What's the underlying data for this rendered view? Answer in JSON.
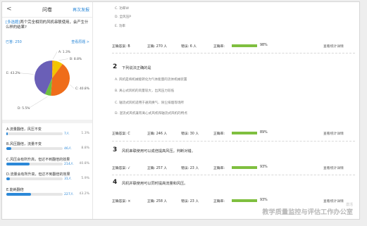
{
  "header": {
    "back": "<",
    "title": "问卷",
    "retake": "再次发报"
  },
  "question": {
    "tag": "[多选题]",
    "text": "两个完全相同的风机串联使用，会产生什么样的结果?"
  },
  "answered": "已答: 250",
  "view_question": "查看原题 >",
  "pie": {
    "labels": [
      "A: 1.3%",
      "B: 8.8%",
      "C: 40.8%",
      "D: 5.5%",
      "E: 43.2%"
    ],
    "colors": [
      "#f29c1f",
      "#f2c500",
      "#ef6d1a",
      "#6fbf3f",
      "#6a5fb7"
    ],
    "values": [
      1.3,
      8.8,
      40.8,
      5.5,
      43.2
    ]
  },
  "stats": [
    {
      "label": "A.流量翻倍，风压不变",
      "count": "7人",
      "pct": "1.3%",
      "fill": 1.3
    },
    {
      "label": "B.风压翻倍，流量不变",
      "count": "46人",
      "pct": "8.8%",
      "fill": 8.8
    },
    {
      "label": "C.风压会有所升高，但达不到翻倍的效果",
      "count": "214人",
      "pct": "40.8%",
      "fill": 40.8
    },
    {
      "label": "D.流量会有所升高，但达不到翻倍的效果",
      "count": "31人",
      "pct": "5.9%",
      "fill": 5.9
    },
    {
      "label": "E.能耗翻倍",
      "count": "227人",
      "pct": "43.2%",
      "fill": 43.2
    }
  ],
  "right": {
    "top_options": [
      "C. 功率W",
      "D. 全风压P",
      "E. 功率"
    ],
    "rows": [
      {
        "correct": "正确答案: B",
        "right_n": "正确: 270 人",
        "wrong_n": "错误: 6 人",
        "rate": "正确率:",
        "rate_v": "98%",
        "link": "查看统计详情"
      },
      {
        "correct": "正确答案: C",
        "right_n": "正确: 246 人",
        "wrong_n": "错误: 30 人",
        "rate": "正确率:",
        "rate_v": "89%",
        "link": "查看统计详情"
      },
      {
        "correct": "正确答案: √",
        "right_n": "正确: 257 人",
        "wrong_n": "错误: 23 人",
        "rate": "正确率:",
        "rate_v": "93%",
        "link": "查看统计详情"
      },
      {
        "correct": "正确答案: ×",
        "right_n": "正确: 258 人",
        "wrong_n": "错误: 23 人",
        "rate": "正确率:",
        "rate_v": "93%",
        "link": "查看统计详情"
      }
    ],
    "q2": {
      "num": "2",
      "text": "下列说法正确的是",
      "options": [
        "A. 风机是将机械能转化为气体能量的流体机械装置",
        "B. 离心式风机的风量较大，出风压力较低",
        "C. 轴流式风机适用于通风换气、除尘排烟等场所",
        "D. 混流式风机兼有离心式风机和轴流式风机的特点"
      ]
    },
    "q3": {
      "num": "3",
      "text": "风机串联使用可以成倍提高风压。判断对错。"
    },
    "q4": {
      "num": "4",
      "text": "风机并联使用可以同时提高流量和风压。"
    }
  },
  "watermark": "教学质量监控与评估工作办公室",
  "watermark_small": "激活"
}
